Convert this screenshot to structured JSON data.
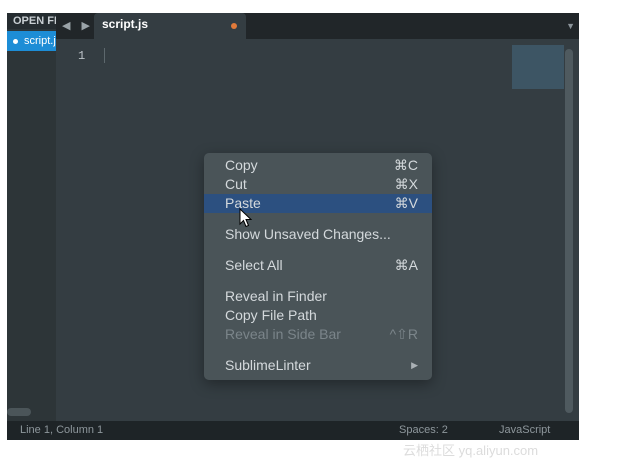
{
  "sidebar": {
    "header": "OPEN FILES",
    "file": "script.js"
  },
  "tabbar": {
    "nav_arrows": "◀ ▶",
    "tab_label": "script.js",
    "menu_glyph": "▼"
  },
  "editor": {
    "line_number": "1"
  },
  "status": {
    "position": "Line 1, Column 1",
    "spaces": "Spaces: 2",
    "syntax": "JavaScript"
  },
  "context_menu": {
    "items": [
      {
        "label": "Copy",
        "shortcut": "⌘C"
      },
      {
        "label": "Cut",
        "shortcut": "⌘X"
      },
      {
        "label": "Paste",
        "shortcut": "⌘V"
      },
      {
        "label": "Show Unsaved Changes...",
        "shortcut": ""
      },
      {
        "label": "Select All",
        "shortcut": "⌘A"
      },
      {
        "label": "Reveal in Finder",
        "shortcut": ""
      },
      {
        "label": "Copy File Path",
        "shortcut": ""
      },
      {
        "label": "Reveal in Side Bar",
        "shortcut": "^⇧R"
      },
      {
        "label": "SublimeLinter",
        "shortcut": "▶"
      }
    ]
  },
  "watermark": "云栖社区 yq.aliyun.com",
  "colors": {
    "accent": "#1d8dd6",
    "highlight": "#2c5080",
    "modified_dot": "#e17a3a"
  },
  "icons": [
    "mouse-pointer-icon",
    "chevron-down-icon",
    "submenu-arrow-icon"
  ]
}
